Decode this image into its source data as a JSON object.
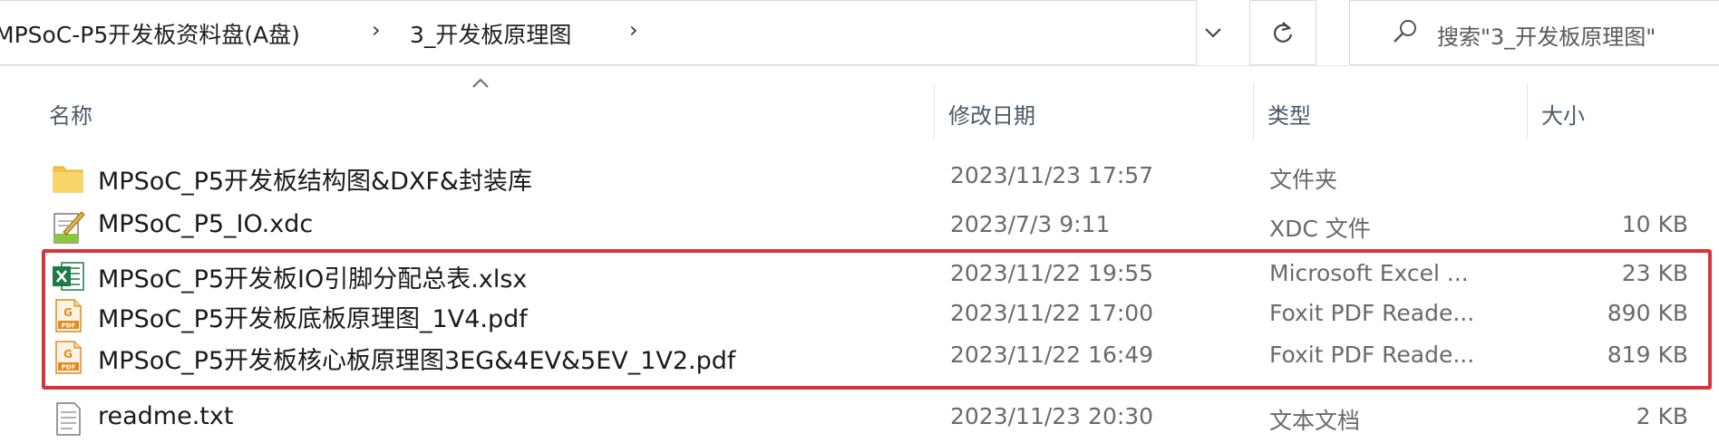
{
  "address_bar": {
    "crumbs": [
      "MPSoC-P5开发板资料盘(A盘)",
      "3_开发板原理图"
    ],
    "separator": "›"
  },
  "search": {
    "placeholder": "搜索\"3_开发板原理图\""
  },
  "columns": {
    "name": "名称",
    "date": "修改日期",
    "type": "类型",
    "size": "大小"
  },
  "files": [
    {
      "name": "MPSoC_P5开发板结构图&DXF&封装库",
      "date": "2023/11/23 17:57",
      "type": "文件夹",
      "size": "",
      "icon": "folder-icon"
    },
    {
      "name": "MPSoC_P5_IO.xdc",
      "date": "2023/7/3 9:11",
      "type": "XDC 文件",
      "size": "10 KB",
      "icon": "xdc-file-icon"
    },
    {
      "name": "MPSoC_P5开发板IO引脚分配总表.xlsx",
      "date": "2023/11/22 19:55",
      "type": "Microsoft Excel ...",
      "size": "23 KB",
      "icon": "excel-file-icon"
    },
    {
      "name": "MPSoC_P5开发板底板原理图_1V4.pdf",
      "date": "2023/11/22 17:00",
      "type": "Foxit PDF Reade...",
      "size": "890 KB",
      "icon": "pdf-file-icon"
    },
    {
      "name": "MPSoC_P5开发板核心板原理图3EG&4EV&5EV_1V2.pdf",
      "date": "2023/11/22 16:49",
      "type": "Foxit PDF Reade...",
      "size": "819 KB",
      "icon": "pdf-file-icon"
    },
    {
      "name": "readme.txt",
      "date": "2023/11/23 20:30",
      "type": "文本文档",
      "size": "2 KB",
      "icon": "text-file-icon"
    }
  ],
  "colors": {
    "highlight": "#d8343c",
    "folder": "#f4c542",
    "excel": "#1f7a45",
    "pdf": "#e08a1e"
  }
}
